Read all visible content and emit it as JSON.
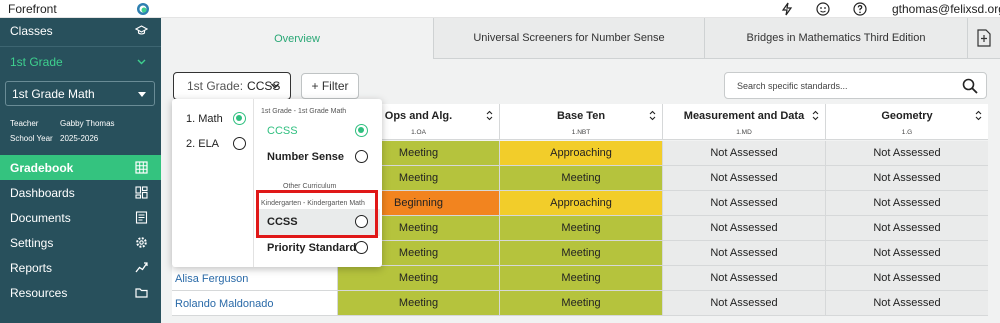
{
  "app": {
    "title": "Forefront",
    "user_email": "gthomas@felixsd.org"
  },
  "topbar_icons": [
    "bolt-icon",
    "face-icon",
    "help-icon"
  ],
  "sidebar": {
    "classes_label": "Classes",
    "grade_label": "1st Grade",
    "class_select": "1st Grade Math",
    "teacher_label": "Teacher",
    "teacher_name": "Gabby Thomas",
    "year_label": "School Year",
    "year_value": "2025-2026",
    "nav": [
      {
        "label": "Gradebook",
        "icon": "grid-icon",
        "active": true
      },
      {
        "label": "Dashboards",
        "icon": "dashboard-icon",
        "active": false
      },
      {
        "label": "Documents",
        "icon": "document-icon",
        "active": false
      },
      {
        "label": "Settings",
        "icon": "gear-icon",
        "active": false
      },
      {
        "label": "Reports",
        "icon": "trend-icon",
        "active": false
      },
      {
        "label": "Resources",
        "icon": "folder-icon",
        "active": false
      }
    ]
  },
  "tabs": [
    "Overview",
    "Universal Screeners for Number Sense",
    "Bridges in Mathematics Third Edition"
  ],
  "toolbar": {
    "grade_prefix": "1st Grade:",
    "standard": "CCSS",
    "filter_label": "+ Filter",
    "search_placeholder": "Search specific standards..."
  },
  "table": {
    "columns": [
      {
        "title": "Ops and Alg.",
        "code": "1.OA"
      },
      {
        "title": "Base Ten",
        "code": "1.NBT"
      },
      {
        "title": "Measurement and Data",
        "code": "1.MD"
      },
      {
        "title": "Geometry",
        "code": "1.G"
      }
    ],
    "rows": [
      {
        "student": "",
        "values": [
          "Meeting",
          "Approaching",
          "Not Assessed",
          "Not Assessed"
        ]
      },
      {
        "student": "",
        "values": [
          "Meeting",
          "Meeting",
          "Not Assessed",
          "Not Assessed"
        ]
      },
      {
        "student": "",
        "values": [
          "Beginning",
          "Approaching",
          "Not Assessed",
          "Not Assessed"
        ]
      },
      {
        "student": "",
        "values": [
          "Meeting",
          "Meeting",
          "Not Assessed",
          "Not Assessed"
        ]
      },
      {
        "student": "",
        "values": [
          "Meeting",
          "Meeting",
          "Not Assessed",
          "Not Assessed"
        ]
      },
      {
        "student": "Alisa Ferguson",
        "values": [
          "Meeting",
          "Meeting",
          "Not Assessed",
          "Not Assessed"
        ]
      },
      {
        "student": "Rolando Maldonado",
        "values": [
          "Meeting",
          "Meeting",
          "Not Assessed",
          "Not Assessed"
        ]
      }
    ],
    "status_colors": {
      "Meeting": "#b5c33d",
      "Approaching": "#f2cd2a",
      "Beginning": "#f2841f",
      "Not Assessed": "#eaebeb"
    }
  },
  "dropdown": {
    "subjects": [
      {
        "label": "1. Math",
        "selected": true
      },
      {
        "label": "2. ELA",
        "selected": false
      }
    ],
    "group_primary": "1st Grade - 1st Grade Math",
    "primary_options": [
      {
        "label": "CCSS",
        "selected": true
      },
      {
        "label": "Number Sense",
        "selected": false
      }
    ],
    "group_other": "Other Curriculum",
    "group_other_sub": "Kindergarten - Kindergarten Math",
    "other_options": [
      {
        "label": "CCSS",
        "selected": false
      },
      {
        "label": "Priority Standards",
        "selected": false
      }
    ]
  },
  "colors": {
    "sidebar_bg": "#28505c",
    "accent_green": "#34c37f",
    "highlight_red": "#e01818"
  }
}
